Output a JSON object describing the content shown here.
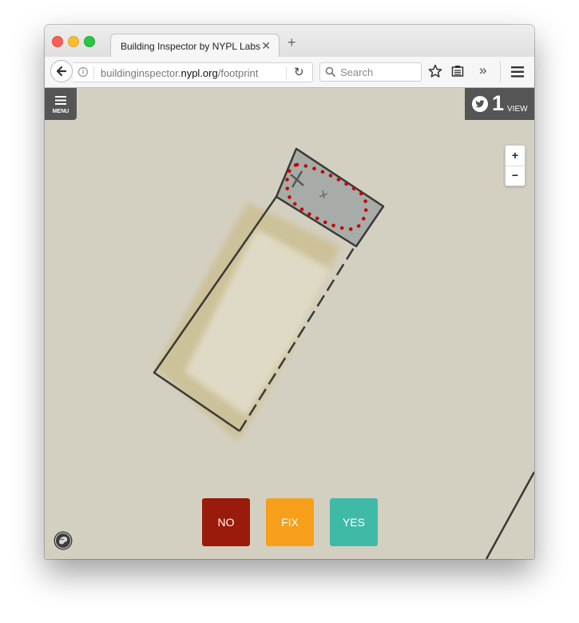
{
  "browser": {
    "tab_title": "Building Inspector by NYPL Labs",
    "url_prefix": "buildinginspector.",
    "url_domain": "nypl.org",
    "url_path": "/footprint",
    "search_placeholder": "Search"
  },
  "page": {
    "menu_label": "MENU",
    "twitter_count": "1",
    "twitter_label": "VIEW",
    "zoom_in": "+",
    "zoom_out": "−",
    "buttons": {
      "no": "NO",
      "fix": "FIX",
      "yes": "YES"
    }
  },
  "colors": {
    "no": "#9a1a0b",
    "fix": "#f79f1b",
    "yes": "#3fbaa6",
    "footprint_dots": "#cc0000"
  },
  "icons": [
    "back-arrow-icon",
    "info-icon",
    "reload-icon",
    "search-icon",
    "star-icon",
    "reader-icon",
    "overflow-icon",
    "hamburger-icon",
    "menu-icon",
    "twitter-icon",
    "nypl-lion-icon"
  ]
}
